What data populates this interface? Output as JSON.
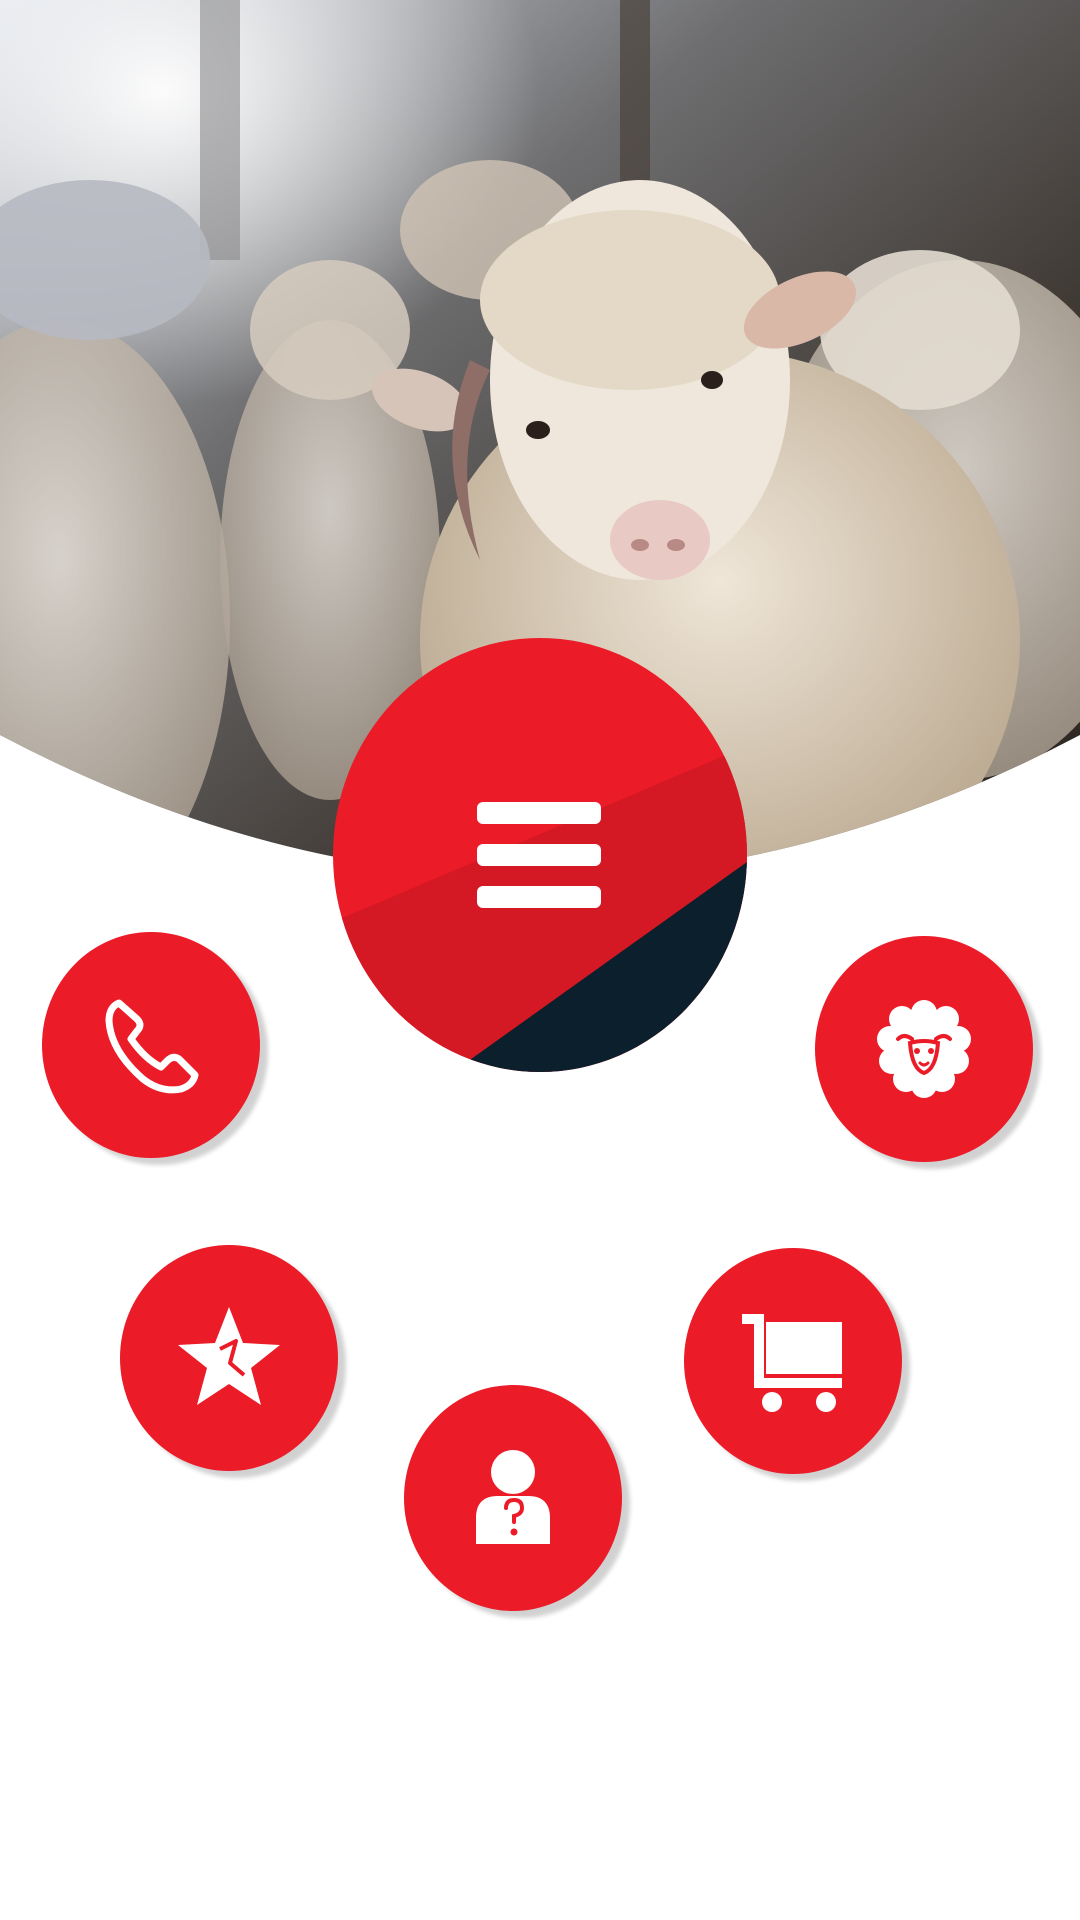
{
  "hero": {
    "image": "sheep-in-barn-photo"
  },
  "menu": {
    "icon": "hamburger-menu-icon"
  },
  "quick_actions": [
    {
      "id": "call",
      "icon": "phone-icon"
    },
    {
      "id": "sheep",
      "icon": "sheep-face-icon"
    },
    {
      "id": "favorites",
      "icon": "star-icon"
    },
    {
      "id": "cart",
      "icon": "shopping-cart-icon"
    },
    {
      "id": "help",
      "icon": "person-question-icon"
    }
  ],
  "colors": {
    "accent": "#eb1b28",
    "accent_dark": "#d41824",
    "navy": "#0b1f2d",
    "background": "#ffffff"
  }
}
